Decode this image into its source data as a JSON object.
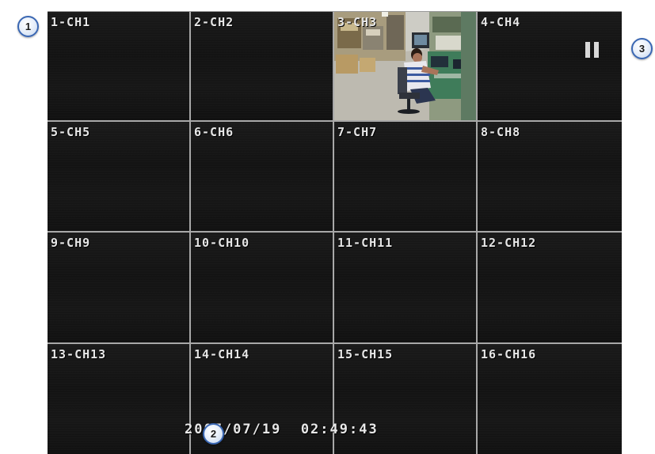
{
  "channels": [
    {
      "label": "1-CH1",
      "live": false
    },
    {
      "label": "2-CH2",
      "live": false
    },
    {
      "label": "3-CH3",
      "live": true
    },
    {
      "label": "4-CH4",
      "live": false
    },
    {
      "label": "5-CH5",
      "live": false
    },
    {
      "label": "6-CH6",
      "live": false
    },
    {
      "label": "7-CH7",
      "live": false
    },
    {
      "label": "8-CH8",
      "live": false
    },
    {
      "label": "9-CH9",
      "live": false
    },
    {
      "label": "10-CH10",
      "live": false
    },
    {
      "label": "11-CH11",
      "live": false
    },
    {
      "label": "12-CH12",
      "live": false
    },
    {
      "label": "13-CH13",
      "live": false
    },
    {
      "label": "14-CH14",
      "live": false
    },
    {
      "label": "15-CH15",
      "live": false
    },
    {
      "label": "16-CH16",
      "live": false
    }
  ],
  "status": {
    "datetime": "2007/07/19  02:49:43",
    "playback_icon": "pause-icon"
  },
  "callouts": {
    "c1": "1",
    "c2": "2",
    "c3": "3"
  },
  "colors": {
    "screen_bg": "#141414",
    "grid_line": "#a8a8a8",
    "label_text": "#e6e6e6",
    "callout_border": "#3a67b3"
  }
}
